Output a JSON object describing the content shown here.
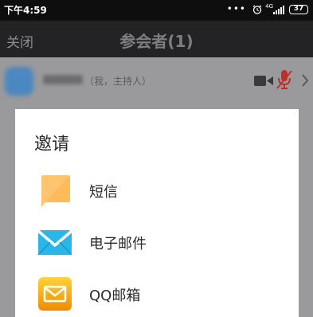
{
  "status_bar": {
    "time": "下午4:59",
    "dots": "•••",
    "network": "4G",
    "battery": "37"
  },
  "header": {
    "close_label": "关闭",
    "title": "参会者(1)"
  },
  "participant": {
    "role": "（我，主持人）"
  },
  "invite_dialog": {
    "title": "邀请",
    "options": [
      {
        "label": "短信",
        "icon": "sms-icon",
        "color": "#ffc56e"
      },
      {
        "label": "电子邮件",
        "icon": "email-icon",
        "color": "#2ab6e8"
      },
      {
        "label": "QQ邮箱",
        "icon": "qq-mail-icon",
        "color": "#f5b400"
      }
    ]
  },
  "colors": {
    "mute_red": "#d9342b",
    "title_bar": "#232325"
  }
}
